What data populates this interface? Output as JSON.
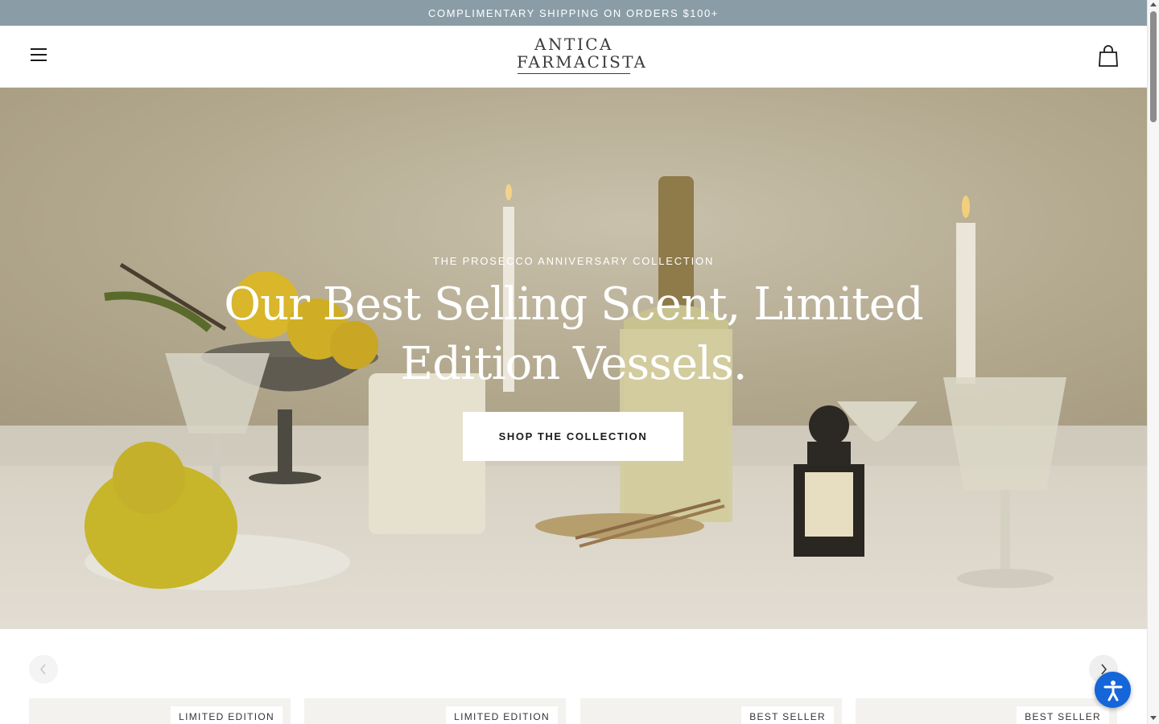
{
  "announcement": {
    "text": "COMPLIMENTARY SHIPPING ON ORDERS $100+"
  },
  "header": {
    "logo_line1": "ANTICA",
    "logo_line2": "FARMACISTA"
  },
  "hero": {
    "eyebrow": "THE PROSECCO ANNIVERSARY COLLECTION",
    "headline_line1": "Our Best Selling Scent, Limited",
    "headline_line2": "Edition Vessels.",
    "cta_label": "SHOP THE COLLECTION"
  },
  "products": [
    {
      "badge": "LIMITED EDITION"
    },
    {
      "badge": "LIMITED EDITION"
    },
    {
      "badge": "BEST SELLER"
    },
    {
      "badge": "BEST SELLER"
    }
  ],
  "icons": {
    "menu": "hamburger-menu-icon",
    "cart": "shopping-bag-icon",
    "prev": "chevron-left-icon",
    "next": "chevron-right-icon",
    "accessibility": "accessibility-icon"
  },
  "colors": {
    "announcement_bg": "#8a9da7",
    "accessibility_button": "#1566d8"
  }
}
